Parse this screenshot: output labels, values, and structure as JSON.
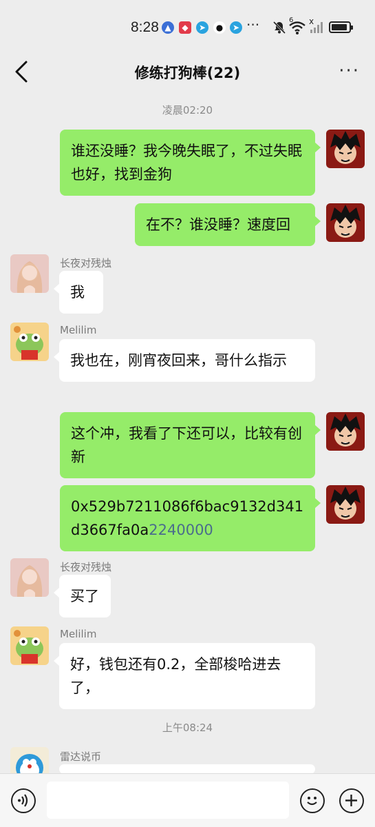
{
  "status_bar": {
    "time": "8:28",
    "more": "···",
    "network": "6",
    "no_signal": "x",
    "colors": {
      "app1": "#3b6fd6",
      "app2": "#e23b4a",
      "telegram": "#2aa3df",
      "qq": "#111111"
    }
  },
  "header": {
    "title": "修练打狗棒(22)",
    "more_label": "···"
  },
  "chat": {
    "time_separators": [
      "凌晨02:20",
      "上午08:24"
    ],
    "messages": [
      {
        "side": "me",
        "text": "谁还没睡？我今晚失眠了，不过失眠也好，找到金狗"
      },
      {
        "side": "me",
        "text": "在不？谁没睡？速度回"
      },
      {
        "side": "other",
        "name": "长夜对残烛",
        "text": "我"
      },
      {
        "side": "other",
        "name": "Melilim",
        "text": "我也在，刚宵夜回来，哥什么指示"
      },
      {
        "side": "me",
        "text": "这个冲，我看了下还可以，比较有创新"
      },
      {
        "side": "me",
        "text_prefix": "0x529b7211086f6bac9132d341d3667fa0a",
        "text_link": "2240000"
      },
      {
        "side": "other",
        "name": "长夜对残烛",
        "text": "买了"
      },
      {
        "side": "other",
        "name": "Melilim",
        "text": "好，钱包还有0.2，全部梭哈进去了，"
      },
      {
        "side": "other",
        "name": "雷达说币",
        "text": ""
      }
    ]
  },
  "input_bar": {
    "placeholder": ""
  },
  "colors": {
    "self_bubble": "#95ec69",
    "other_bubble": "#ffffff",
    "background": "#ededed",
    "link": "#4a6d8c"
  }
}
